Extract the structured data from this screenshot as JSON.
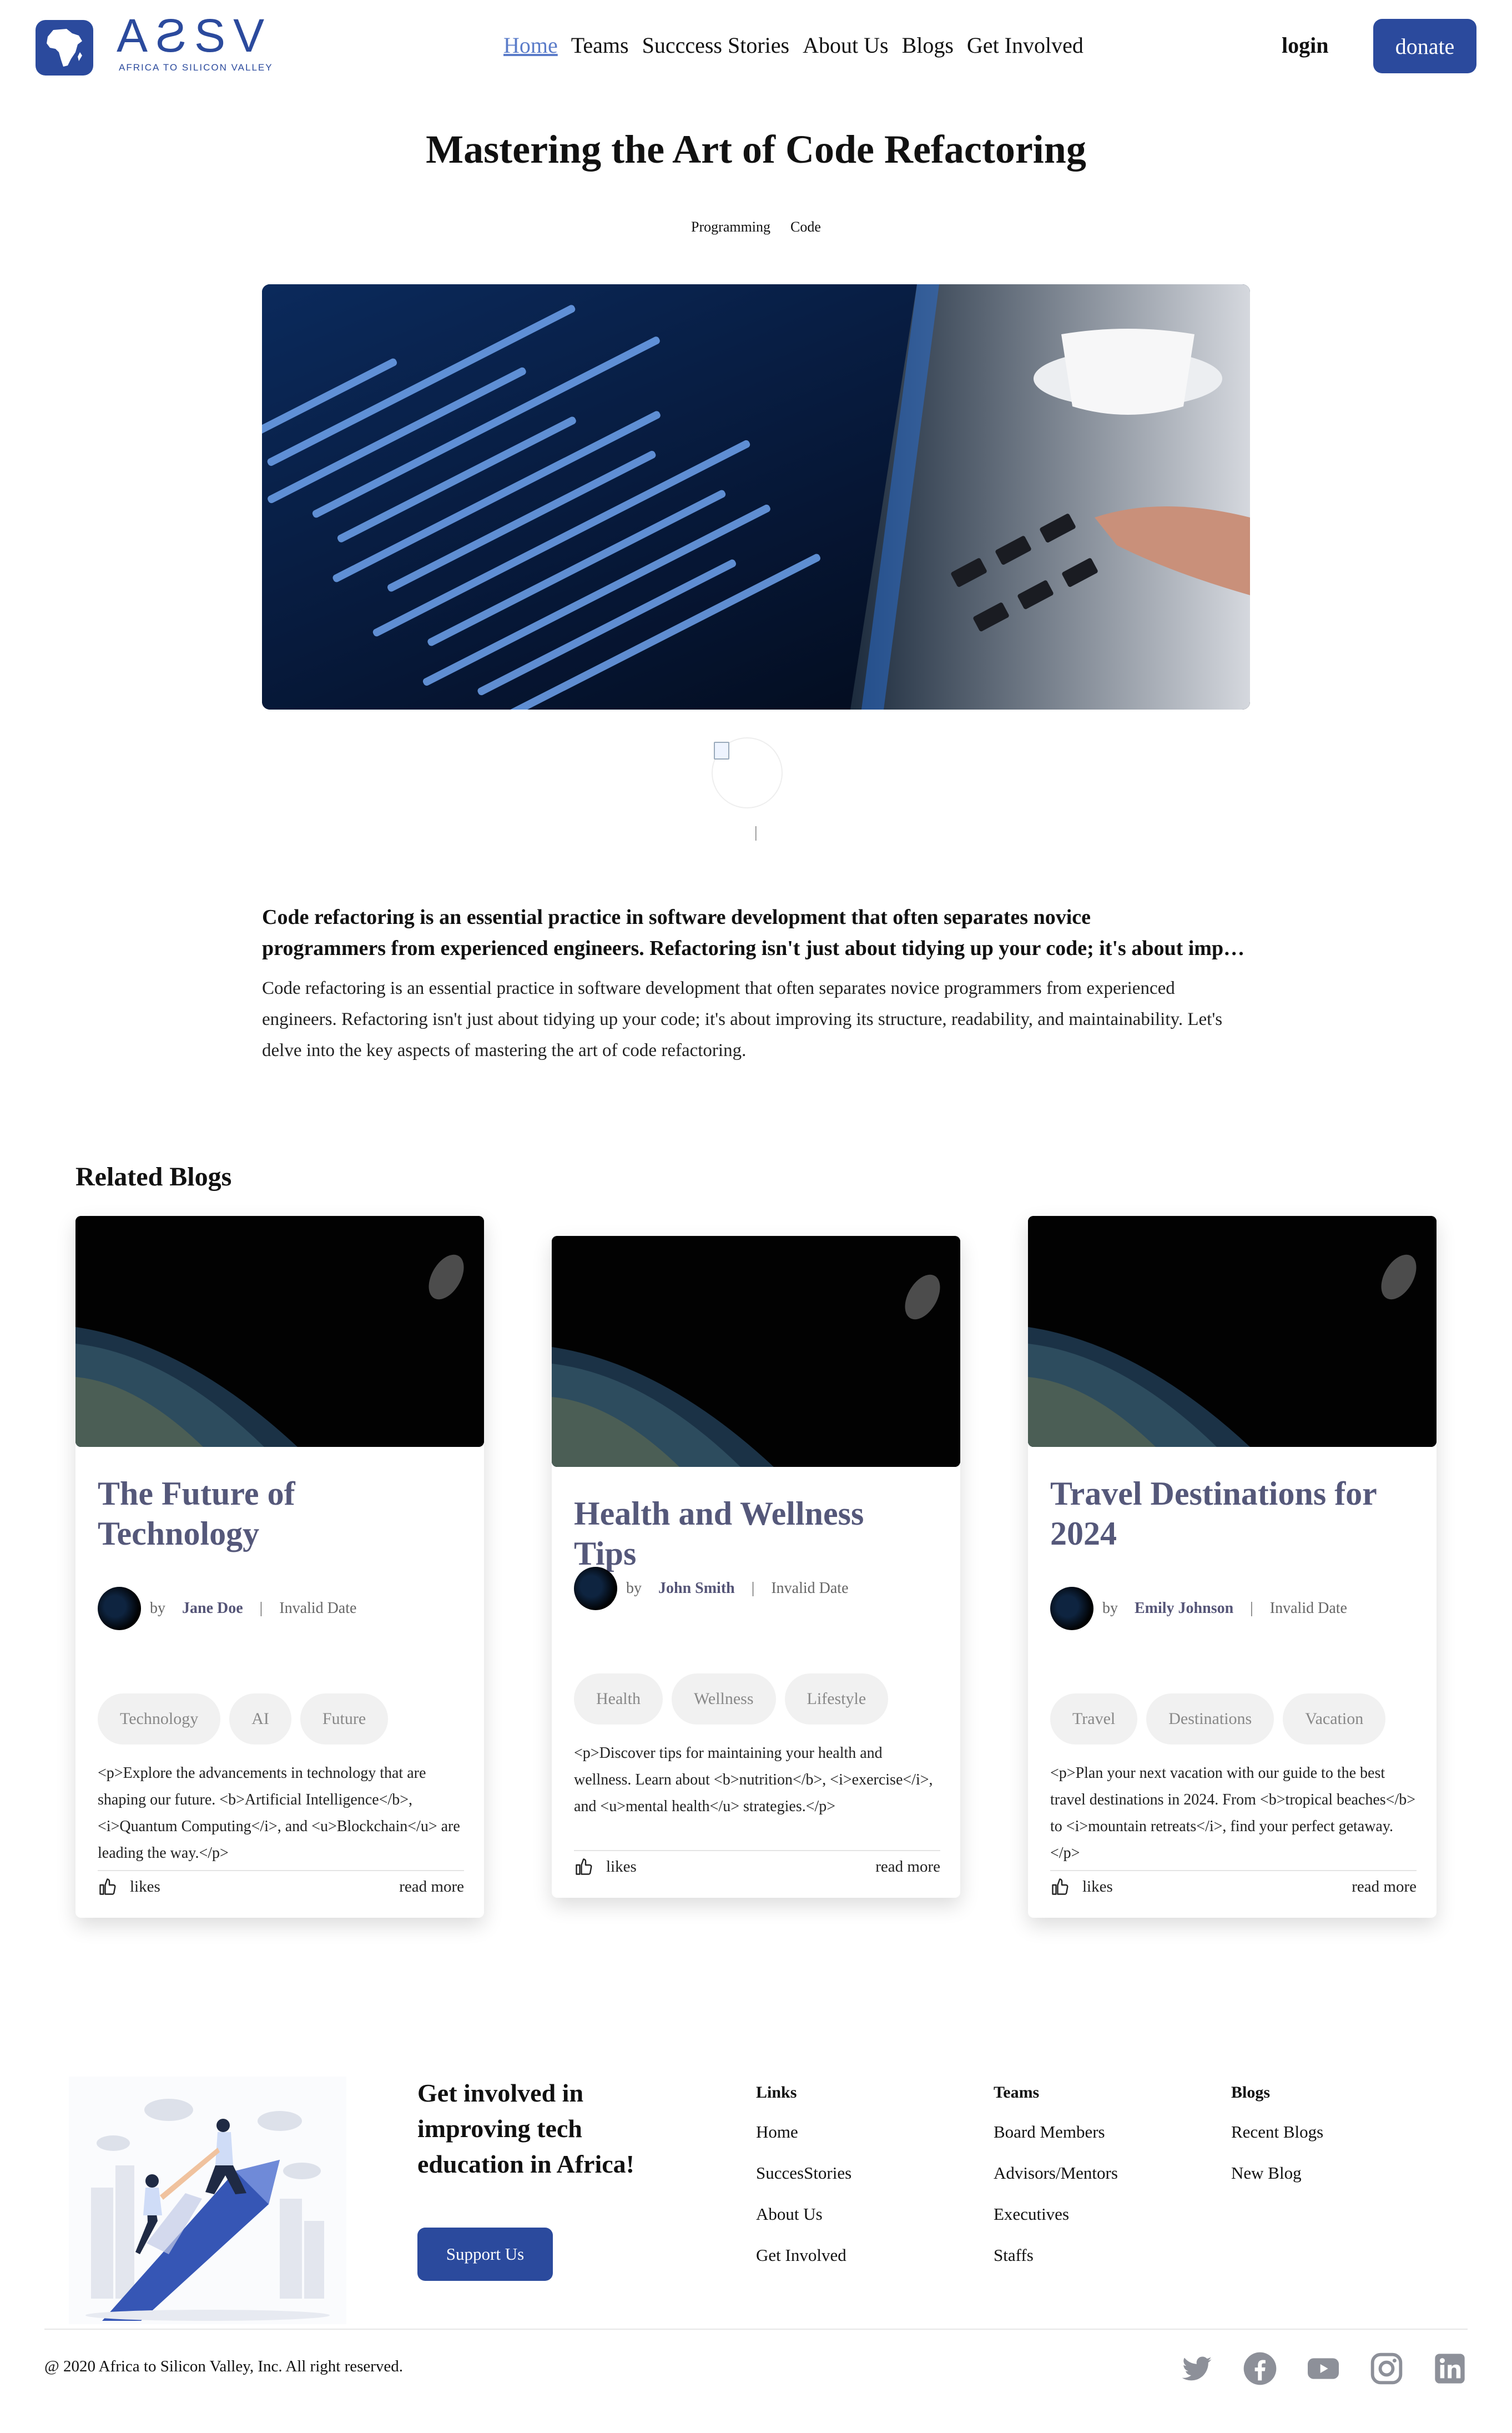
{
  "nav": {
    "logo_text": "AƧSV",
    "logo_tagline": "AFRICA TO SILICON VALLEY",
    "links": [
      "Home",
      "Teams",
      "Succcess Stories",
      "About Us",
      "Blogs",
      "Get Involved"
    ],
    "login": "login",
    "donate": "donate"
  },
  "post": {
    "title": "Mastering the Art of Code Refactoring",
    "tags": [
      "Programming",
      "Code"
    ],
    "meta_separator": "|",
    "lead_line_1": "Code refactoring is an essential practice in software development that often separates novice",
    "lead_line_2": "programmers from experienced engineers. Refactoring isn't just about tidying up your code; it's about improving its structure",
    "body": "Code refactoring is an essential practice in software development that often separates novice programmers from experienced engineers. Refactoring isn't just about tidying up your code; it's about improving its structure, readability, and maintainability. Let's delve into the key aspects of mastering the art of code refactoring."
  },
  "related": {
    "heading": "Related Blogs",
    "by_label": "by",
    "cards": [
      {
        "title": "The Future of Technology",
        "author": "Jane Doe",
        "date": "Invalid Date",
        "tags": [
          "Technology",
          "AI",
          "Future"
        ],
        "excerpt": "<p>Explore the advancements in technology that are shaping our future. <b>Artificial Intelligence</b>, <i>Quantum Computing</i>, and <u>Blockchain</u> are leading the way.</p>",
        "likes": "likes",
        "read_more": "read more"
      },
      {
        "title": "Health and Wellness Tips",
        "author": "John Smith",
        "date": "Invalid Date",
        "tags": [
          "Health",
          "Wellness",
          "Lifestyle"
        ],
        "excerpt": "<p>Discover tips for maintaining your health and wellness. Learn about <b>nutrition</b>, <i>exercise</i>, and <u>mental health</u> strategies.</p>",
        "likes": "likes",
        "read_more": "read more"
      },
      {
        "title": "Travel Destinations for 2024",
        "author": "Emily Johnson",
        "date": "Invalid Date",
        "tags": [
          "Travel",
          "Destinations",
          "Vacation"
        ],
        "excerpt": "<p>Plan your next vacation with our guide to the best travel destinations in 2024. From <b>tropical beaches</b> to <i>mountain retreats</i>, find your perfect getaway.</p>",
        "likes": "likes",
        "read_more": "read more"
      }
    ]
  },
  "footer": {
    "cta": "Get involved in improving tech education in Africa!",
    "support": "Support Us",
    "columns": [
      {
        "heading": "Links",
        "items": [
          "Home",
          "SuccesStories",
          "About Us",
          "Get Involved"
        ]
      },
      {
        "heading": "Teams",
        "items": [
          "Board Members",
          "Advisors/Mentors",
          "Executives",
          "Staffs"
        ]
      },
      {
        "heading": "Blogs",
        "items": [
          "Recent Blogs",
          "New Blog"
        ]
      }
    ],
    "copyright": "@ 2020 Africa to Silicon Valley, Inc. All right reserved.",
    "social_icons": [
      "twitter-icon",
      "facebook-icon",
      "youtube-icon",
      "instagram-icon",
      "linkedin-icon"
    ]
  },
  "colors": {
    "brand": "#2b4a9d",
    "active_link": "#5b7cc9",
    "card_title": "#55587a"
  }
}
